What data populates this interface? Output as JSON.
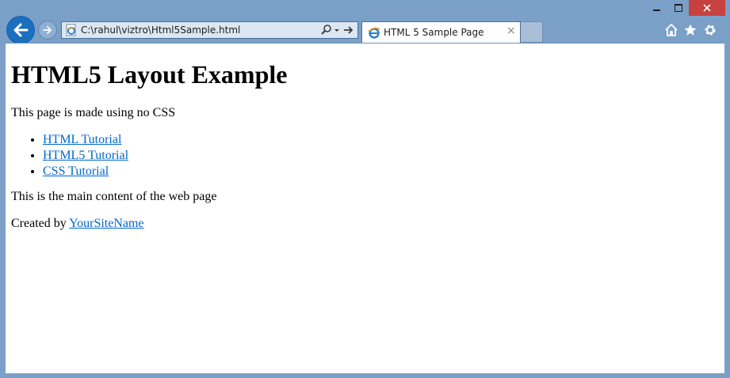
{
  "browser": {
    "address": "C:\\rahul\\viztro\\Html5Sample.html",
    "tab_title": "HTML 5 Sample Page",
    "tab_close": "×"
  },
  "page": {
    "title": "HTML5 Layout Example",
    "intro": "This page is made using no CSS",
    "links": [
      "HTML Tutorial",
      "HTML5 Tutorial",
      "CSS Tutorial"
    ],
    "main_content": "This is the main content of the web page",
    "footer_prefix": "Created by",
    "footer_link": "YourSiteName"
  },
  "colors": {
    "chrome": "#7aa0c8",
    "close_button": "#c7413f",
    "back_button": "#1b6fbf",
    "link": "#0066cc"
  },
  "icons": [
    "minimize-icon",
    "maximize-icon",
    "close-icon",
    "back-arrow-icon",
    "forward-arrow-icon",
    "ie-page-icon",
    "search-icon",
    "dropdown-icon",
    "go-arrow-icon",
    "home-icon",
    "star-icon",
    "gear-icon"
  ]
}
